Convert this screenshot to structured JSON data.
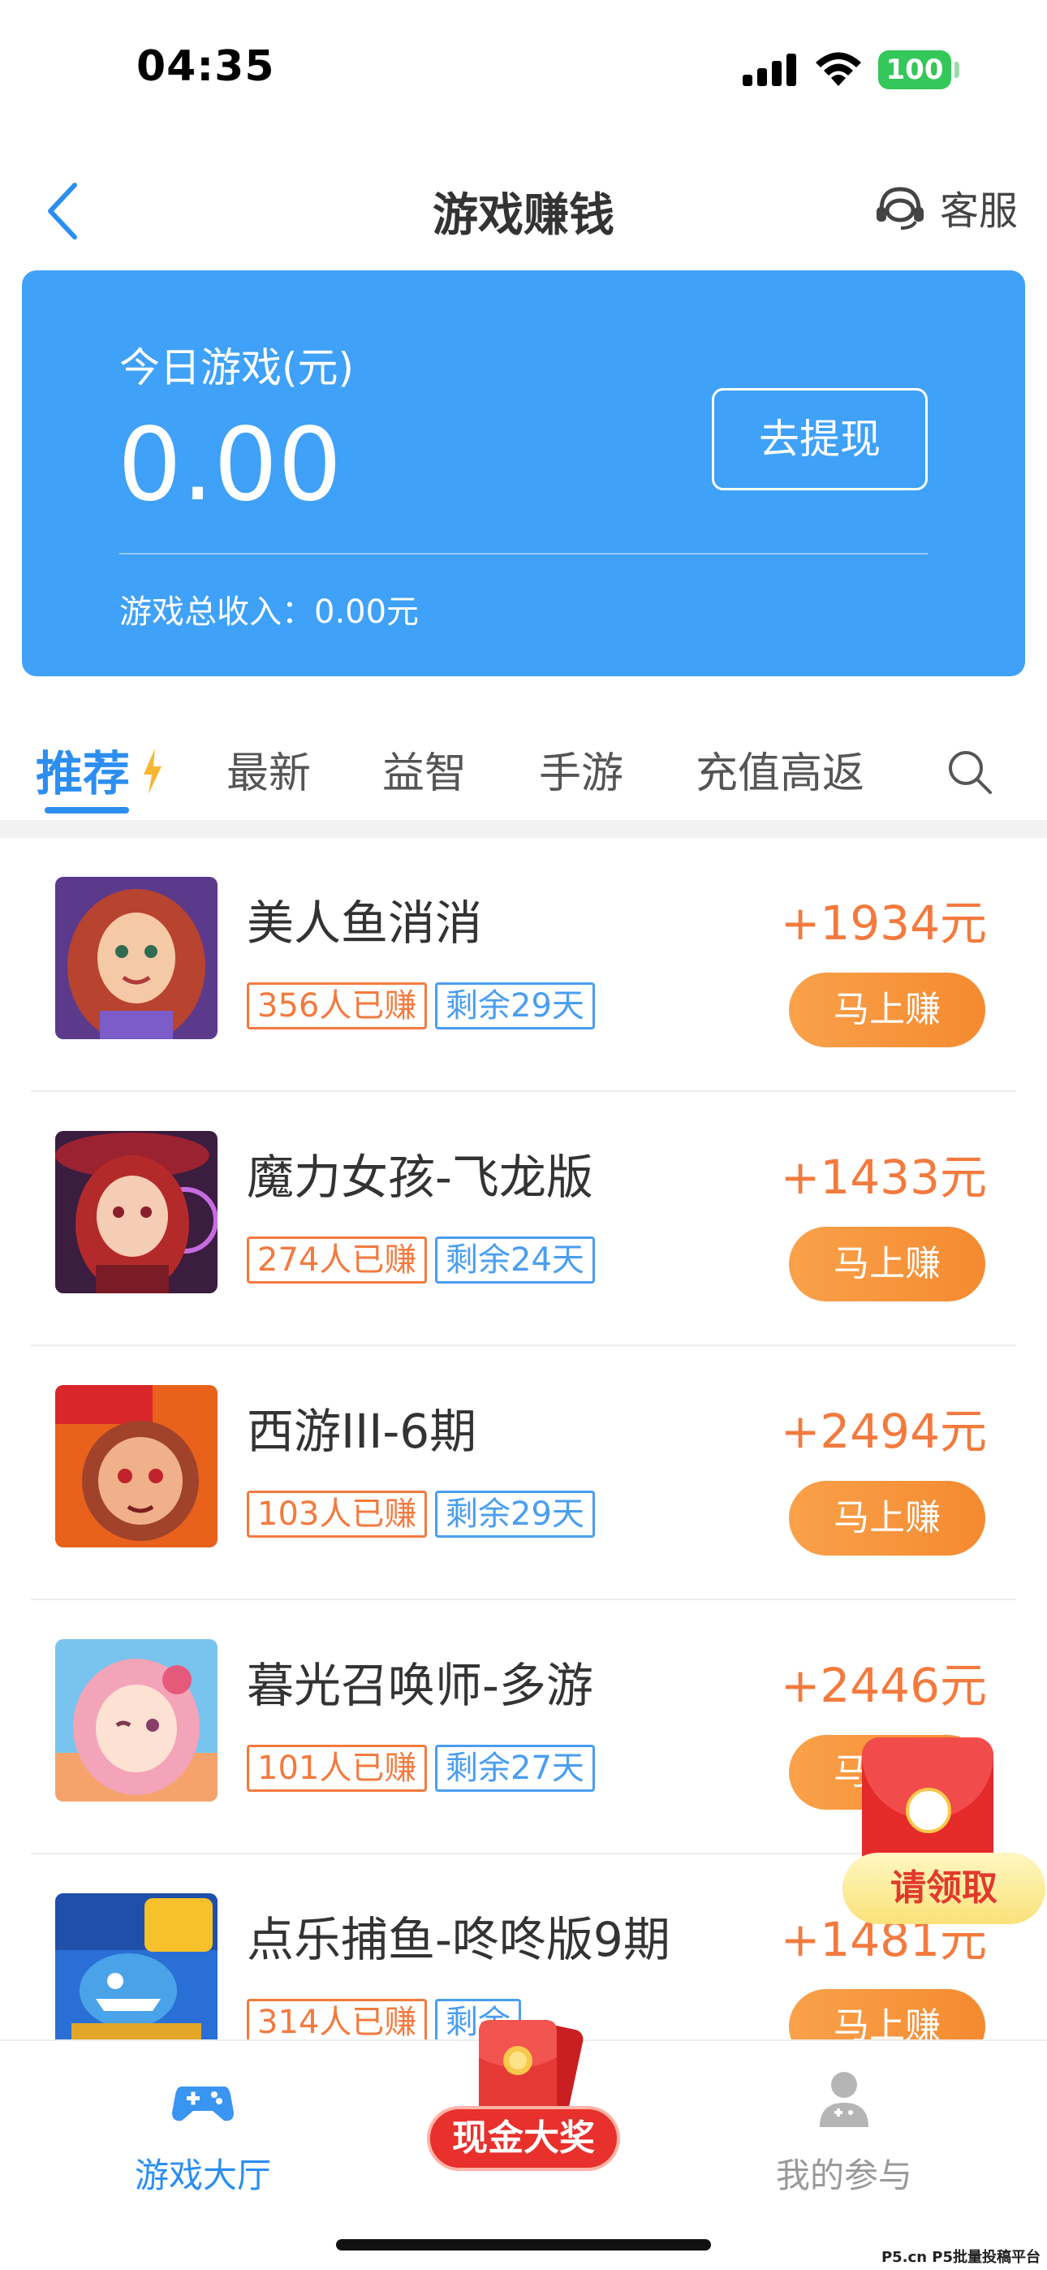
{
  "status_bar": {
    "time": "04:35",
    "battery": "100"
  },
  "nav": {
    "title": "游戏赚钱",
    "service_label": "客服"
  },
  "earnings": {
    "label": "今日游戏(元)",
    "amount": "0.00",
    "withdraw_label": "去提现",
    "total_text": "游戏总收入：0.00元"
  },
  "tabs": [
    {
      "label": "推荐"
    },
    {
      "label": "最新"
    },
    {
      "label": "益智"
    },
    {
      "label": "手游"
    },
    {
      "label": "充值高返"
    }
  ],
  "games": [
    {
      "name": "美人鱼消消",
      "joined": "356人已赚",
      "remaining": "剩余29天",
      "reward": "+1934元",
      "button": "马上赚"
    },
    {
      "name": "魔力女孩-飞龙版",
      "joined": "274人已赚",
      "remaining": "剩余24天",
      "reward": "+1433元",
      "button": "马上赚"
    },
    {
      "name": "西游III-6期",
      "joined": "103人已赚",
      "remaining": "剩余29天",
      "reward": "+2494元",
      "button": "马上赚"
    },
    {
      "name": "暮光召唤师-多游",
      "joined": "101人已赚",
      "remaining": "剩余27天",
      "reward": "+2446元",
      "button": "马上赚"
    },
    {
      "name": "点乐捕鱼-咚咚版9期",
      "joined": "314人已赚",
      "remaining": "剩余",
      "reward": "+1481元",
      "button": "马上赚"
    }
  ],
  "float_packet": {
    "label": "请领取"
  },
  "tab_bar": {
    "hall_label": "游戏大厅",
    "center_label": "现金大奖",
    "mine_label": "我的参与"
  },
  "watermark": "P5.cn P5批量投稿平台"
}
